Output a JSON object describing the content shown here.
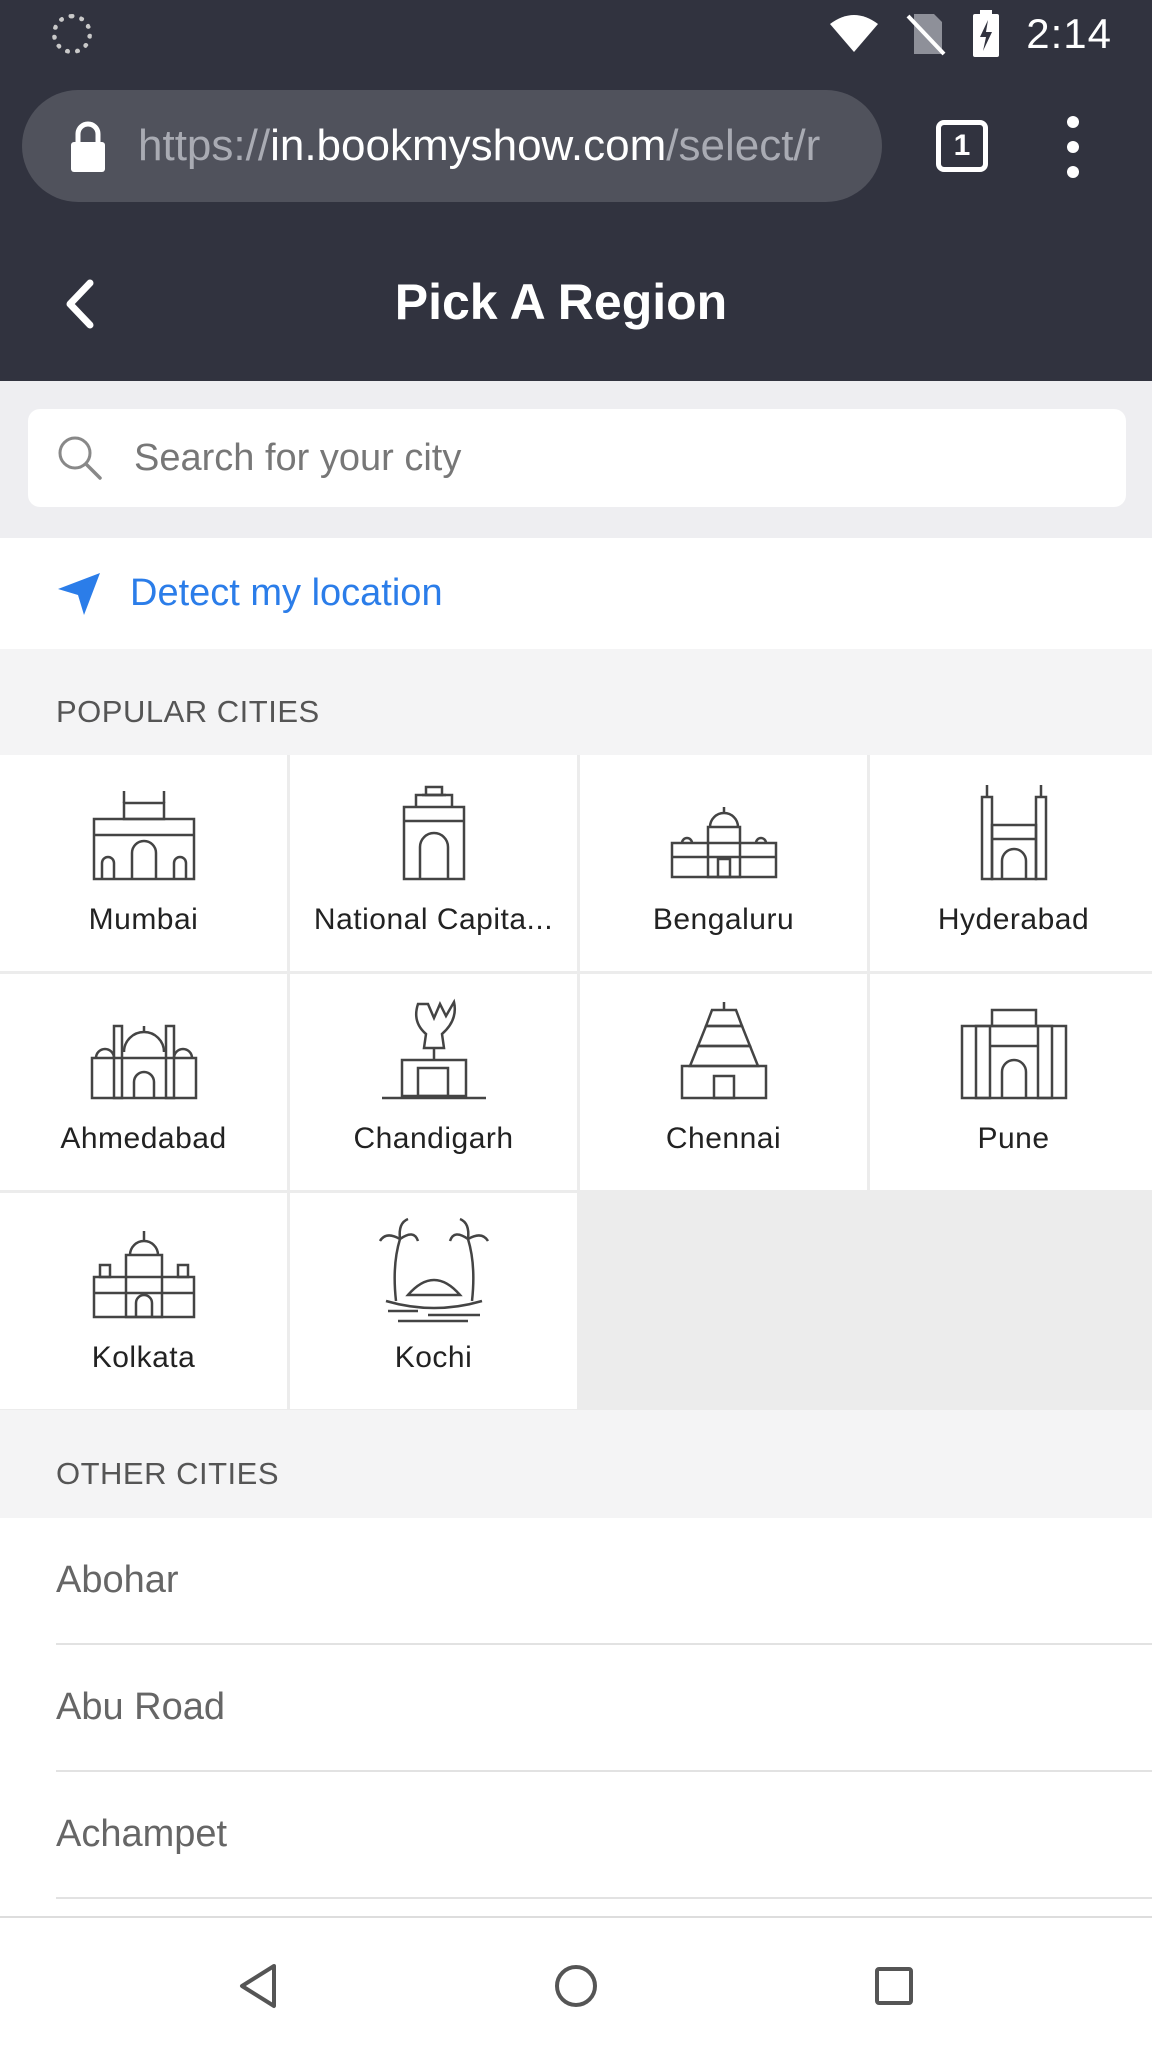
{
  "status_bar": {
    "time": "2:14",
    "icons": [
      "loading-spinner-icon",
      "wifi-icon",
      "no-sim-icon",
      "battery-charging-icon"
    ]
  },
  "browser": {
    "url_scheme": "https://",
    "url_host": "in.bookmyshow.com",
    "url_path": "/select/r",
    "tab_count": "1"
  },
  "header": {
    "title": "Pick A Region"
  },
  "search": {
    "placeholder": "Search for your city",
    "value": ""
  },
  "detect": {
    "label": "Detect my location"
  },
  "popular": {
    "heading": "POPULAR CITIES",
    "cities": [
      {
        "name": "Mumbai",
        "icon": "gateway-of-india-icon"
      },
      {
        "name": "National Capita...",
        "icon": "india-gate-icon"
      },
      {
        "name": "Bengaluru",
        "icon": "vidhana-soudha-icon"
      },
      {
        "name": "Hyderabad",
        "icon": "charminar-icon"
      },
      {
        "name": "Ahmedabad",
        "icon": "mosque-icon"
      },
      {
        "name": "Chandigarh",
        "icon": "open-hand-monument-icon"
      },
      {
        "name": "Chennai",
        "icon": "temple-gopuram-icon"
      },
      {
        "name": "Pune",
        "icon": "shaniwar-wada-icon"
      },
      {
        "name": "Kolkata",
        "icon": "victoria-memorial-icon"
      },
      {
        "name": "Kochi",
        "icon": "palm-trees-boat-icon"
      }
    ]
  },
  "other": {
    "heading": "OTHER CITIES",
    "cities": [
      "Abohar",
      "Abu Road",
      "Achampet"
    ]
  },
  "colors": {
    "header_bg": "#31333f",
    "accent_blue": "#2b7de9",
    "section_bg": "#f4f4f5"
  }
}
